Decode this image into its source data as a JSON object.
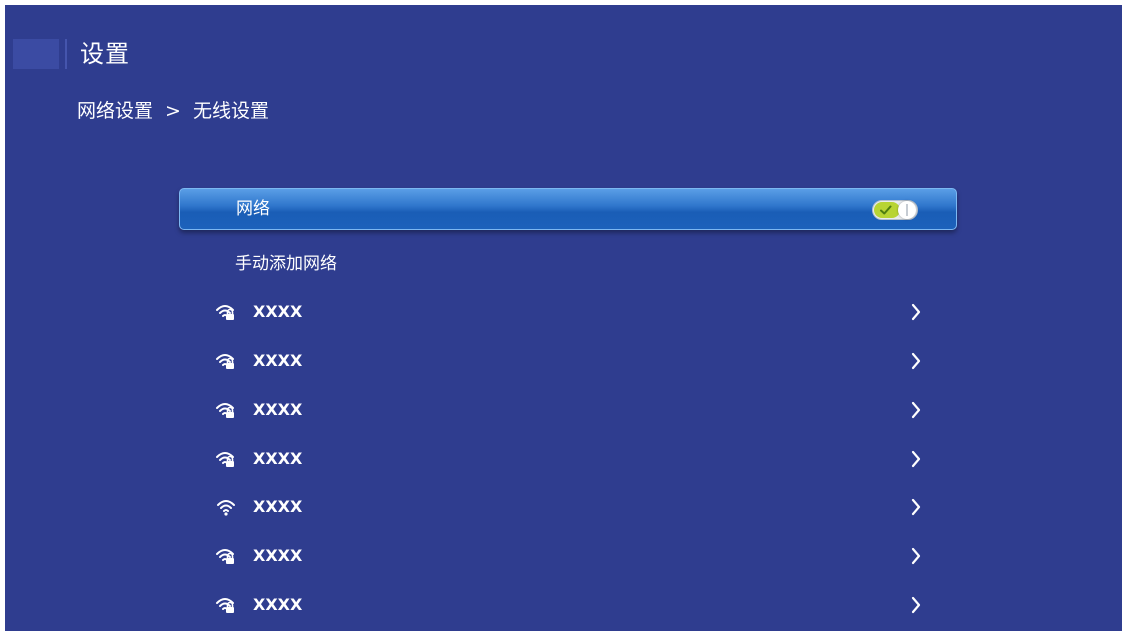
{
  "header": {
    "title": "设置"
  },
  "breadcrumb": {
    "parent": "网络设置",
    "separator": ">",
    "current": "无线设置"
  },
  "network_toggle": {
    "label": "网络",
    "state": "on"
  },
  "manual_add": {
    "label": "手动添加网络"
  },
  "wifi_list": [
    {
      "ssid": "XXXX",
      "icon": "wifi-lock-icon",
      "secured": true
    },
    {
      "ssid": "XXXX",
      "icon": "wifi-lock-icon",
      "secured": true
    },
    {
      "ssid": "XXXX",
      "icon": "wifi-lock-icon",
      "secured": true
    },
    {
      "ssid": "XXXX",
      "icon": "wifi-lock-icon",
      "secured": true
    },
    {
      "ssid": "XXXX",
      "icon": "wifi-icon",
      "secured": false
    },
    {
      "ssid": "XXXX",
      "icon": "wifi-lock-icon",
      "secured": true
    },
    {
      "ssid": "XXXX",
      "icon": "wifi-lock-icon",
      "secured": true
    }
  ],
  "colors": {
    "background": "#2f3d8f",
    "highlight": "#2f76cc",
    "toggle_on": "#b8d434"
  }
}
